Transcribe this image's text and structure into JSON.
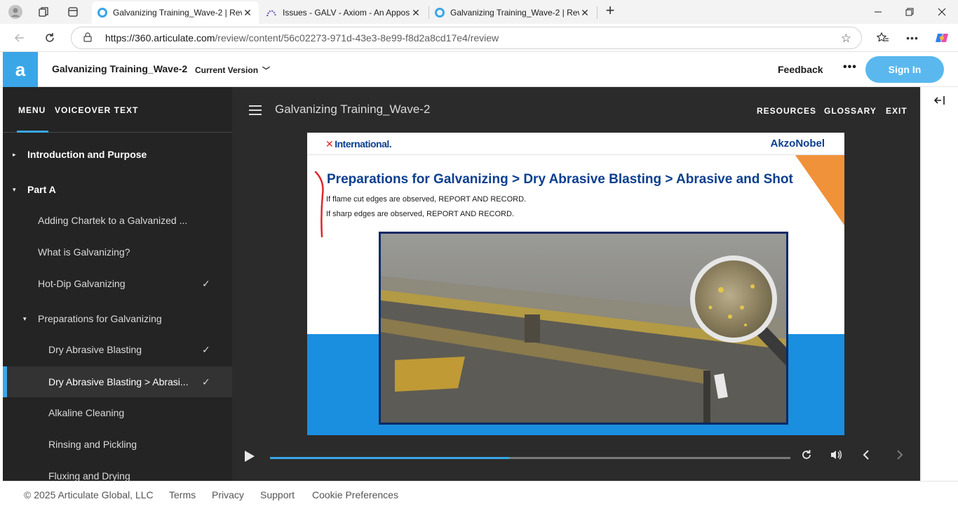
{
  "browser": {
    "tabs": [
      {
        "title": "Galvanizing Training_Wave-2 | Rev",
        "favicon": "articulate-icon",
        "active": true
      },
      {
        "title": "Issues - GALV - Axiom - An Appos",
        "favicon": "axiom-icon",
        "active": false
      },
      {
        "title": "Galvanizing Training_Wave-2 | Rev",
        "favicon": "articulate-icon",
        "active": false
      }
    ],
    "close_glyph": "✕",
    "new_tab_glyph": "+",
    "url_host": "https://360.articulate.com",
    "url_path": "/review/content/56c02273-971d-43e3-8e99-f8d2a8cd17e4/review"
  },
  "app_header": {
    "logo_glyph": "a",
    "title": "Galvanizing Training_Wave-2",
    "version_label": "Current Version",
    "feedback_label": "Feedback",
    "more_glyph": "•••",
    "signin_label": "Sign In",
    "accent_color": "#3aa6e8"
  },
  "sidebar": {
    "tabs": [
      "MENU",
      "VOICEOVER TEXT"
    ],
    "items": [
      {
        "label": "Introduction and Purpose",
        "level": 0,
        "arrow": "▸",
        "checked": false
      },
      {
        "label": "Part A",
        "level": 0,
        "arrow": "▾",
        "checked": false
      },
      {
        "label": "Adding Chartek to a Galvanized ...",
        "level": 1,
        "arrow": "",
        "checked": false
      },
      {
        "label": "What is Galvanizing?",
        "level": 1,
        "arrow": "",
        "checked": false
      },
      {
        "label": "Hot-Dip Galvanizing",
        "level": 1,
        "arrow": "",
        "checked": true
      },
      {
        "label": "Preparations for Galvanizing",
        "level": 1,
        "arrow": "▾",
        "checked": false
      },
      {
        "label": "Dry Abrasive Blasting",
        "level": 2,
        "arrow": "",
        "checked": true
      },
      {
        "label": "Dry Abrasive Blasting > Abrasi...",
        "level": 2,
        "arrow": "",
        "checked": true,
        "selected": true
      },
      {
        "label": "Alkaline Cleaning",
        "level": 2,
        "arrow": "",
        "checked": false
      },
      {
        "label": "Rinsing and Pickling",
        "level": 2,
        "arrow": "",
        "checked": false
      },
      {
        "label": "Fluxing and Drying",
        "level": 2,
        "arrow": "",
        "checked": false
      }
    ],
    "check_glyph": "✓"
  },
  "player": {
    "course_title": "Galvanizing Training_Wave-2",
    "top_links": [
      "RESOURCES",
      "GLOSSARY",
      "EXIT"
    ],
    "progress": 0.46
  },
  "slide": {
    "brand_left": "International.",
    "brand_left_mark": "✕",
    "brand_right": "AkzoNobel",
    "heading": "Preparations for Galvanizing > Dry Abrasive Blasting > Abrasive and Shot",
    "lines": [
      "If flame cut edges are observed, REPORT AND RECORD.",
      "If sharp edges are observed, REPORT AND RECORD."
    ],
    "colors": {
      "navy": "#0b3f8f",
      "orange": "#f0923a",
      "band": "#1a8fe0"
    }
  },
  "footer": {
    "copyright": "© 2025 Articulate Global, LLC",
    "links": [
      "Terms",
      "Privacy",
      "Support",
      "Cookie Preferences"
    ]
  }
}
